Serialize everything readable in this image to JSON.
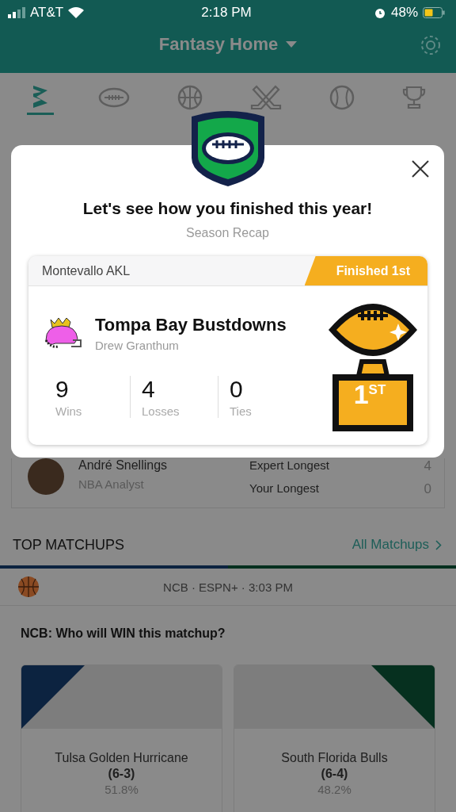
{
  "status_bar": {
    "carrier": "AT&T",
    "time": "2:18 PM",
    "battery": "48%"
  },
  "header": {
    "title": "Fantasy Home"
  },
  "sport_tabs": [
    {
      "kind": "home",
      "selected": true
    },
    {
      "kind": "football",
      "selected": false
    },
    {
      "kind": "basketball",
      "selected": false
    },
    {
      "kind": "hockey",
      "selected": false
    },
    {
      "kind": "baseball",
      "selected": false
    },
    {
      "kind": "trophy",
      "selected": false
    }
  ],
  "expert": {
    "name": "André Snellings",
    "role": "NBA Analyst",
    "stats": [
      {
        "label": "Expert Longest",
        "value": "4"
      },
      {
        "label": "Your Longest",
        "value": "0"
      }
    ]
  },
  "top_matchups": {
    "title": "TOP MATCHUPS",
    "link": "All Matchups"
  },
  "matchup": {
    "info": "NCB · ESPN+ · 3:03 PM",
    "question": "NCB: Who will WIN this matchup?",
    "teams": [
      {
        "name": "Tulsa Golden Hurricane",
        "record": "(6-3)",
        "pct": "51.8%",
        "color": "#0c2340"
      },
      {
        "name": "South Florida Bulls",
        "record": "(6-4)",
        "pct": "48.2%",
        "color": "#06301f"
      }
    ]
  },
  "modal": {
    "title": "Let's see how you finished this year!",
    "subtitle": "Season Recap",
    "league": "Montevallo AKL",
    "finish": "Finished 1st",
    "team": "Tompa Bay Bustdowns",
    "owner": "Drew Granthum",
    "record": [
      {
        "value": "9",
        "label": "Wins"
      },
      {
        "value": "4",
        "label": "Losses"
      },
      {
        "value": "0",
        "label": "Ties"
      }
    ],
    "trophy": {
      "rank": "1",
      "suffix": "ST"
    }
  }
}
